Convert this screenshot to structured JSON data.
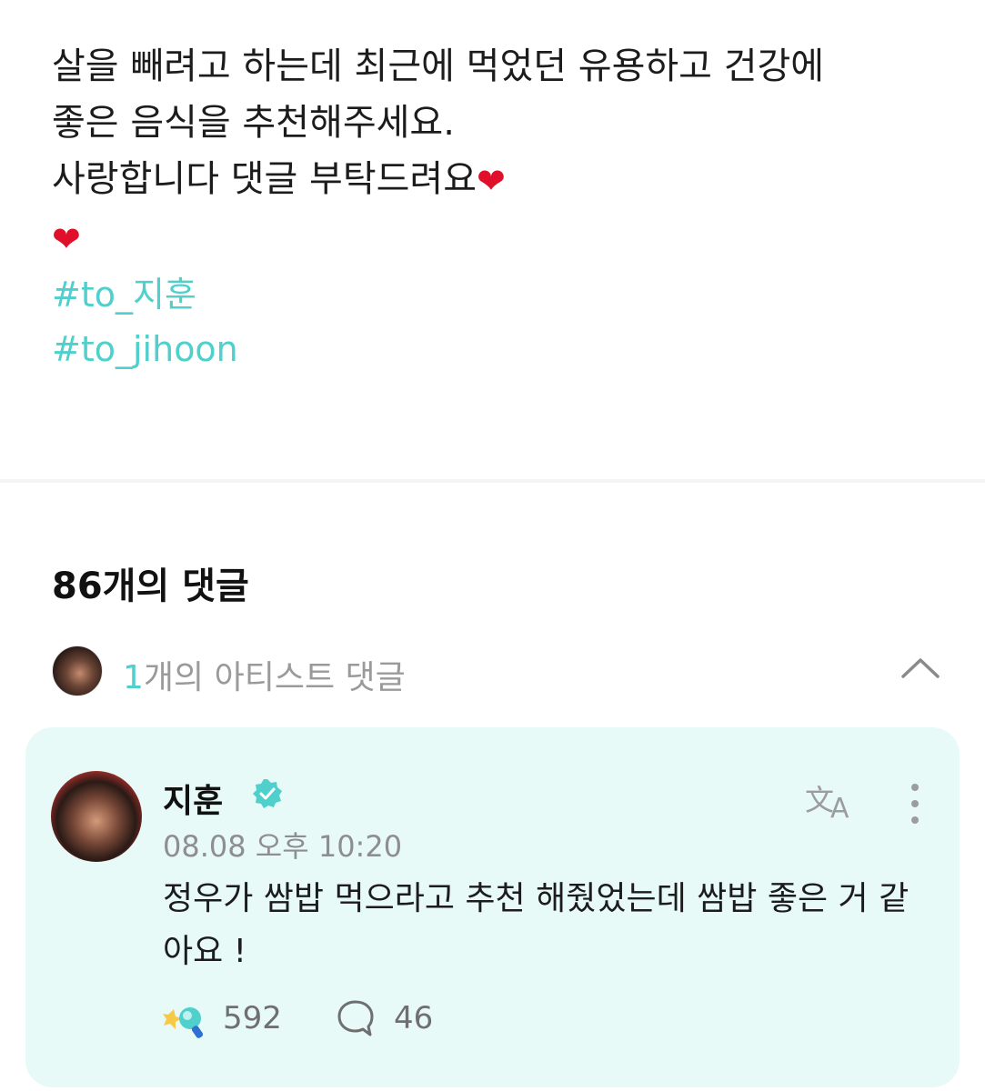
{
  "post": {
    "line1": "살을 빼려고 하는데 최근에 먹었던 유용하고 건강에",
    "line2": "좋은 음식을 추천해주세요.",
    "line3": "사랑합니다 댓글 부탁드려요",
    "heart": "❤",
    "hashtags": [
      "#to_지훈",
      "#to_jihoon"
    ]
  },
  "comments": {
    "count_label": "86개의 댓글"
  },
  "artist_comments": {
    "count": "1",
    "label": "개의 아티스트 댓글"
  },
  "artist_comment": {
    "name": "지훈",
    "timestamp": "08.08 오후 10:20",
    "text": "정우가 쌈밥 먹으라고 추천 해줬었는데 쌈밥 좋은 거 같아요 !",
    "cheer_count": "592",
    "reply_count": "46"
  },
  "colors": {
    "accent": "#4fd0cc",
    "card_background": "#e7faf8",
    "heart": "#e0102a"
  },
  "icons": [
    "heart-icon",
    "chevron-up-icon",
    "verified-badge-icon",
    "translate-icon",
    "more-vertical-icon",
    "cheer-lightstick-icon",
    "reply-bubble-icon"
  ]
}
